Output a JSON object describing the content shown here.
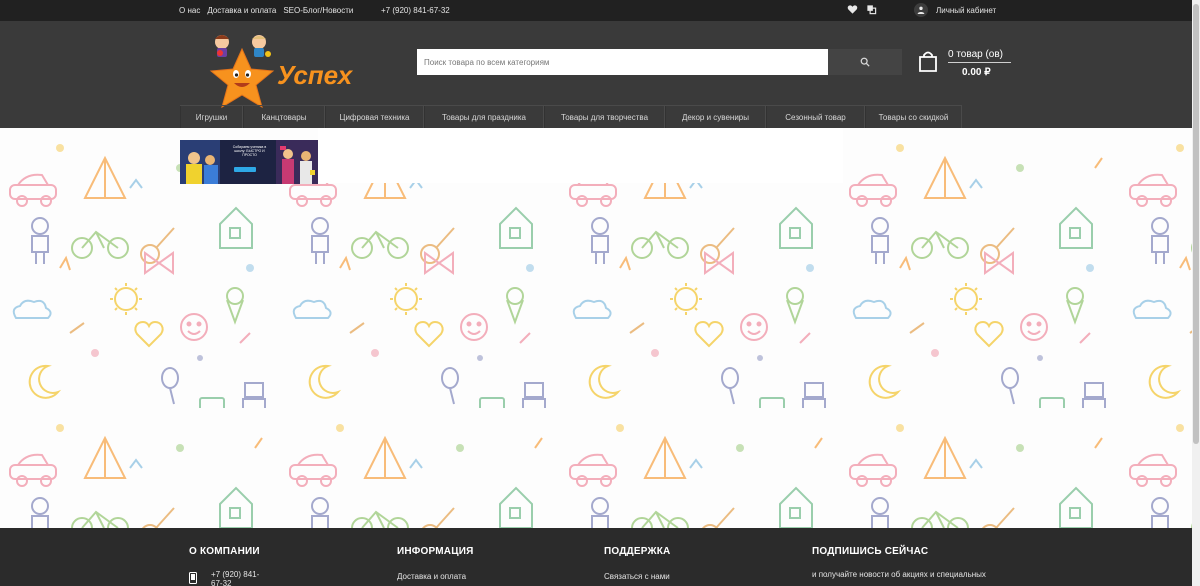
{
  "topbar": {
    "links": [
      "О нас",
      "Доставка и оплата",
      "SEO-Блог/Новости"
    ],
    "phone": "+7 (920) 841-67-32",
    "account_label": "Личный кабинет",
    "icons": [
      "heart-icon",
      "compare-icon",
      "user-icon"
    ]
  },
  "header": {
    "logo_text": "Успех",
    "search_placeholder": "Поиск товара по всем категориям",
    "search_icon": "search-icon",
    "cart": {
      "count_text": "0 товар (ов)",
      "total_text": "0.00 ₽",
      "icon": "shopping-bag-icon"
    }
  },
  "nav": [
    {
      "label": "Игрушки"
    },
    {
      "label": "Канцтовары"
    },
    {
      "label": "Цифровая техника"
    },
    {
      "label": "Товары для праздника"
    },
    {
      "label": "Товары для творчества"
    },
    {
      "label": "Декор и сувениры"
    },
    {
      "label": "Сезонный товар"
    },
    {
      "label": "Товары со скидкой"
    }
  ],
  "banner": {
    "headline": "Собираем ученика в школу: БЫСТРО И ПРОСТО"
  },
  "footer": {
    "columns": [
      {
        "title": "О КОМПАНИИ",
        "item": "+7 (920) 841-67-32",
        "icon": "phone-icon"
      },
      {
        "title": "ИНФОРМАЦИЯ",
        "item": "Доставка и оплата"
      },
      {
        "title": "ПОДДЕРЖКА",
        "item": "Связаться с нами"
      },
      {
        "title": "ПОДПИШИСЬ СЕЙЧАС",
        "item": "и получайте новости об акциях и специальных"
      }
    ]
  },
  "colors": {
    "topbar_bg": "#212121",
    "header_bg": "#3a3a3a",
    "footer_bg": "#2b2b2b",
    "logo_orange": "#f7921e"
  }
}
